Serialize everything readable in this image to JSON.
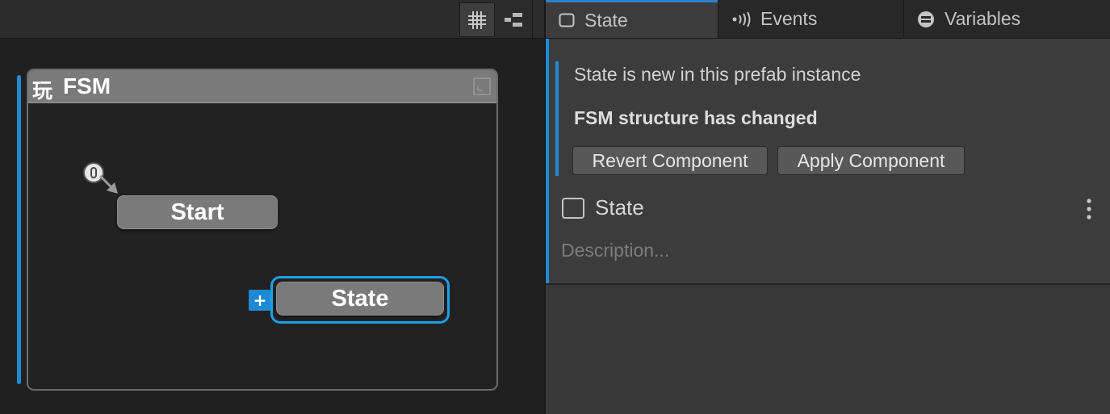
{
  "graph": {
    "toolbar": {
      "grid_icon": "grid-icon",
      "layout_icon": "layout-icon"
    },
    "fsm": {
      "logo": "玩",
      "title": "FSM",
      "maximize_icon": "maximize-icon"
    },
    "nodes": {
      "start_label": "Start",
      "state_label": "State",
      "add_button": "+"
    }
  },
  "inspector": {
    "tabs": [
      {
        "label": "State",
        "icon": "square-icon"
      },
      {
        "label": "Events",
        "icon": "broadcast-icon"
      },
      {
        "label": "Variables",
        "icon": "variables-icon"
      }
    ],
    "prefab": {
      "message": "State is new in this prefab instance",
      "structure_changed": "FSM structure has changed",
      "revert_label": "Revert Component",
      "apply_label": "Apply Component"
    },
    "state": {
      "name": "State",
      "description_placeholder": "Description..."
    }
  },
  "colors": {
    "accent": "#1e8ad6",
    "selection": "#1e9fe8",
    "node": "#7a7a7a"
  }
}
